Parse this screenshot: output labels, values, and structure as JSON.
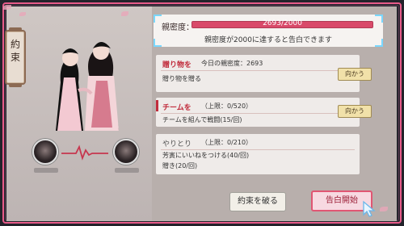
{
  "side_tab": {
    "label": "約束"
  },
  "affinity": {
    "label": "親密度：",
    "current": 2693,
    "max": 2000,
    "display": "2693/2000",
    "note": "親密度が2000に達すると告白できます"
  },
  "tasks": [
    {
      "title": "贈り物を",
      "lines": [
        "今日の親密度：2693",
        "贈り物を贈る"
      ],
      "button": "向かう"
    },
    {
      "title": "チームを",
      "lines": [
        "（上限：0/520）",
        "チームを組んで戦闘(15/回)"
      ],
      "button": "向かう"
    },
    {
      "title": "やりとり",
      "lines": [
        "（上限：0/210）",
        "芳寅にいいねをつける(40/回)",
        "贈き(20/回)"
      ],
      "button": ""
    }
  ],
  "buttons": {
    "promise": "約束を破る",
    "confess": "告白開始"
  },
  "colors": {
    "accent": "#e85b8a",
    "primary_red": "#c12d3d",
    "bar_fill": "#d94a6a"
  }
}
